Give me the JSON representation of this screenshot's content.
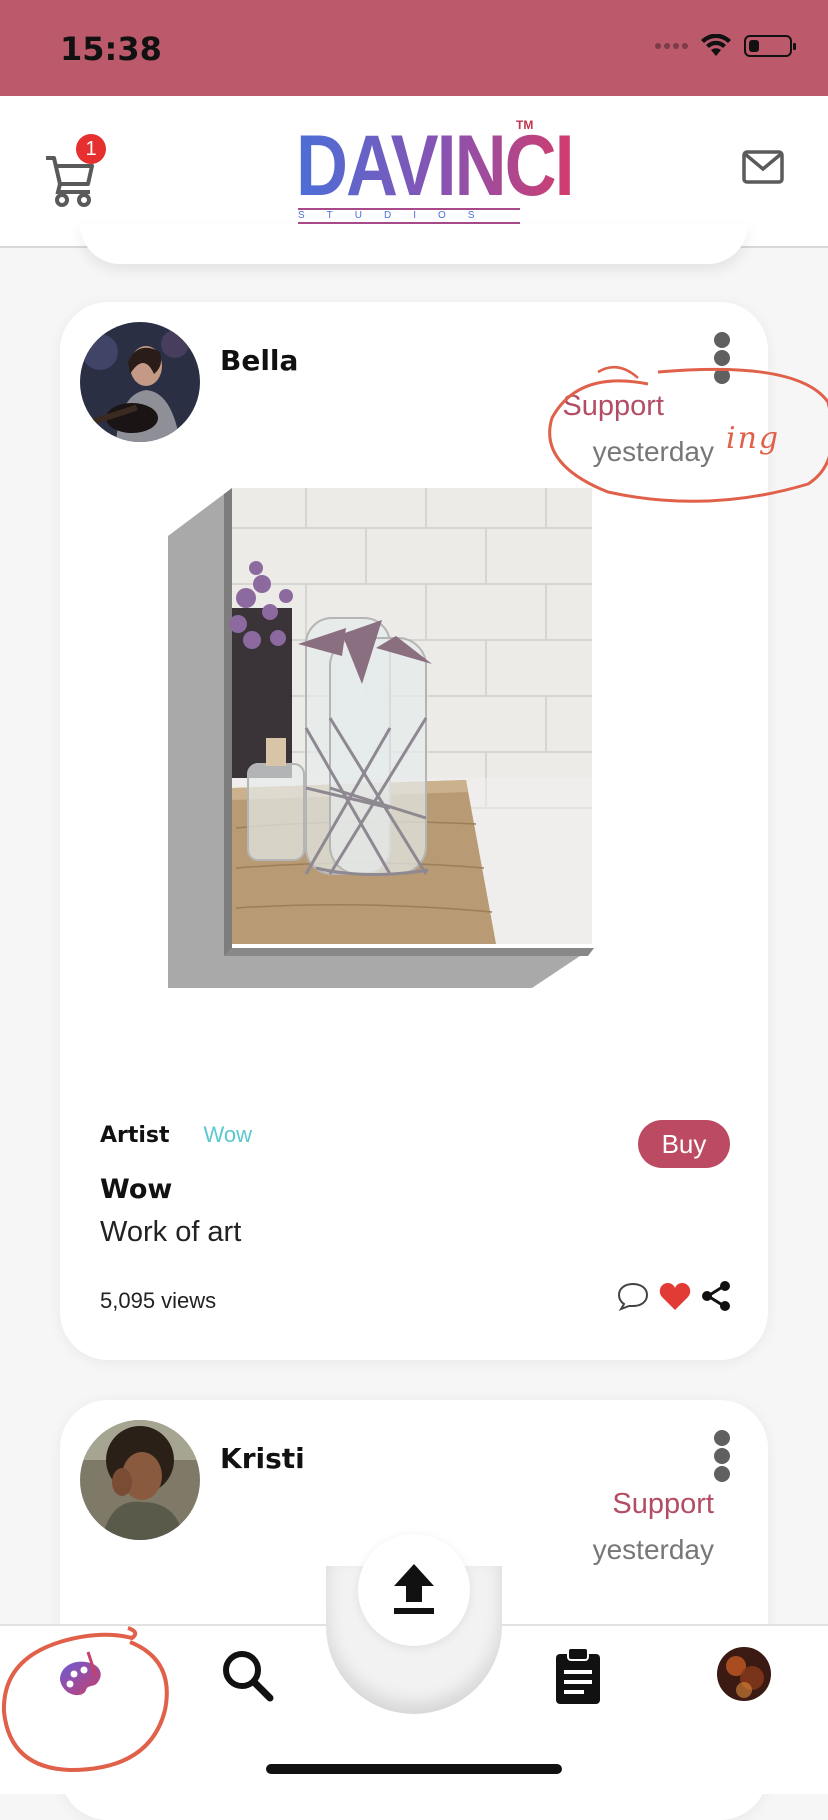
{
  "status_bar": {
    "time": "15:38",
    "battery_level": 0.25,
    "background_color": "#bc5a6c"
  },
  "header": {
    "cart_badge_count": "1",
    "logo_text": "DAVINCI",
    "logo_subtitle": "STUDIOS",
    "logo_trademark": "TM"
  },
  "posts": [
    {
      "username": "Bella",
      "support_label": "Support",
      "annotation_text": "ing",
      "time": "yesterday",
      "artist_label": "Artist",
      "artist_name": "Wow",
      "buy_label": "Buy",
      "title": "Wow",
      "description": "Work of art",
      "views": "5,095 views"
    },
    {
      "username": "Kristi",
      "support_label": "Support",
      "time": "yesterday"
    }
  ],
  "nav": {
    "items": [
      "art-palette-icon",
      "search-icon",
      "upload-icon",
      "clipboard-icon",
      "profile-avatar"
    ]
  },
  "colors": {
    "accent": "#bc4a62",
    "artist_name": "#5bc7cf",
    "annotation": "#e0604a"
  }
}
